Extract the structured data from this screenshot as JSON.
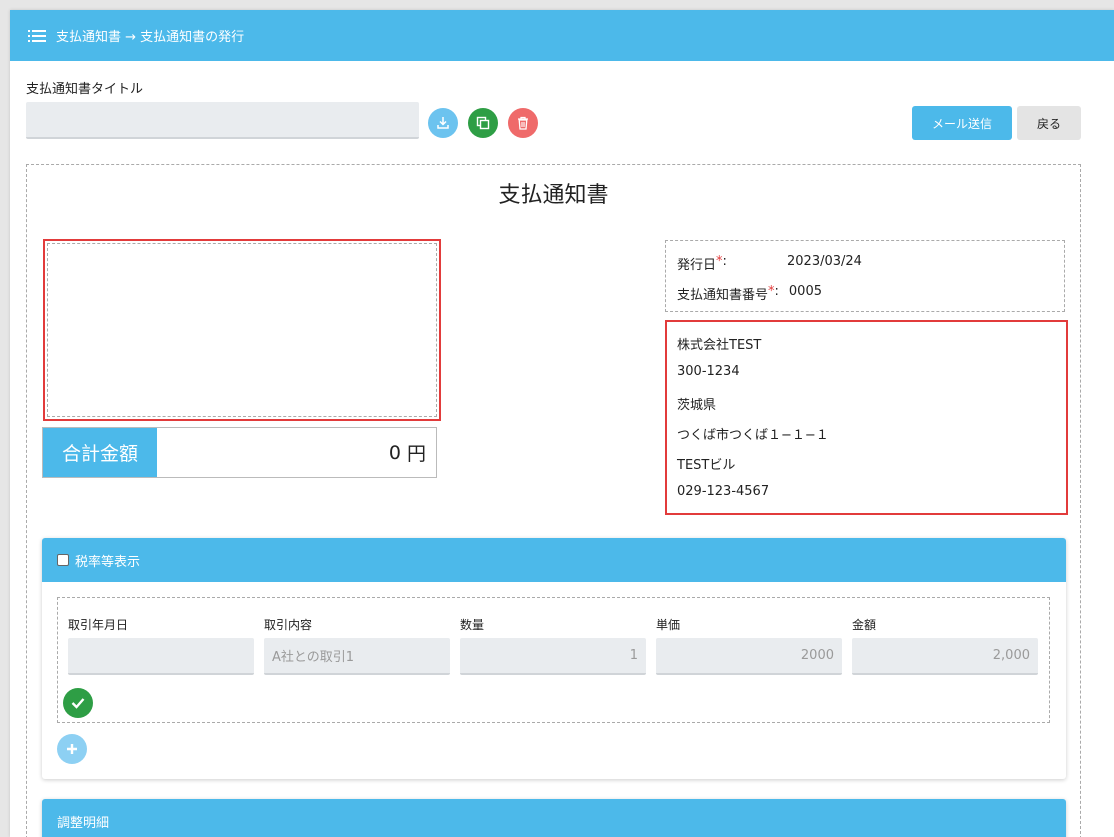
{
  "header": {
    "breadcrumb": "支払通知書 → 支払通知書の発行"
  },
  "form": {
    "title_label": "支払通知書タイトル",
    "title_value": "",
    "mail_button": "メール送信",
    "back_button": "戻る"
  },
  "document": {
    "heading": "支払通知書",
    "total_label": "合計金額",
    "total_amount": "0",
    "total_unit": "円",
    "issue_date_label": "発行日",
    "issue_date_required": "*",
    "issue_date_colon": ":",
    "issue_date": "2023/03/24",
    "number_label": "支払通知書番号",
    "number_required": "*",
    "number_colon": ":",
    "number": "0005",
    "company": {
      "name": "株式会社TEST",
      "postal": "300-1234",
      "prefecture": "茨城県",
      "city": "つくば市つくば１−１−１",
      "building": "TESTビル",
      "phone": "029-123-4567"
    }
  },
  "items_panel": {
    "header": "税率等表示",
    "checkbox_checked": false,
    "columns": [
      "取引年月日",
      "取引内容",
      "数量",
      "単価",
      "金額"
    ],
    "row": {
      "date": "",
      "description": "A社との取引1",
      "quantity": "1",
      "unit_price": "2000",
      "amount": "2,000"
    }
  },
  "adjust_panel": {
    "header": "調整明細"
  },
  "colors": {
    "accent": "#4cb9ea",
    "success": "#2e9e45",
    "danger": "#ef6a6a",
    "highlight_border": "#e23b3b"
  }
}
